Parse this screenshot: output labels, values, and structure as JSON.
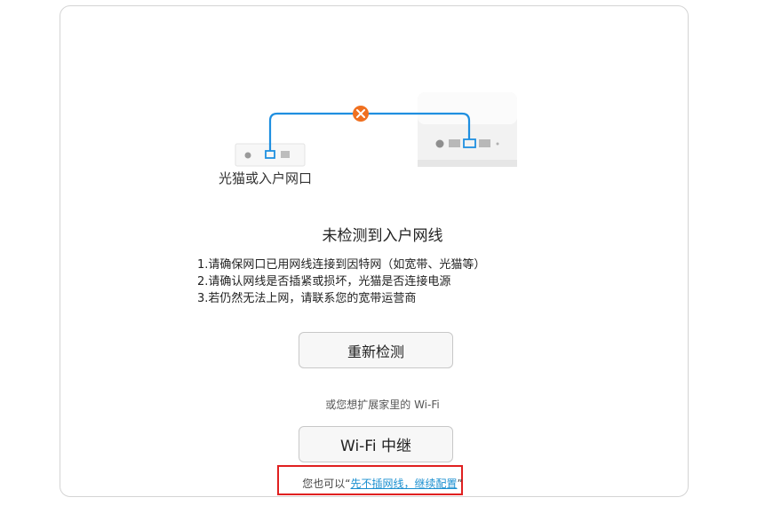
{
  "diagram": {
    "modem_label": "光猫或入户网口",
    "colors": {
      "cable": "#1f8fe0",
      "error": "#f07020"
    },
    "icons": [
      "modem-device-icon",
      "router-device-icon",
      "disconnect-error-icon"
    ]
  },
  "main": {
    "title": "未检测到入户网线",
    "steps": [
      "1.请确保网口已用网线连接到因特网（如宽带、光猫等）",
      "2.请确认网线是否插紧或损坏，光猫是否连接电源",
      "3.若仍然无法上网，请联系您的宽带运营商"
    ],
    "redetect_label": "重新检测",
    "extend_hint": "或您想扩展家里的 Wi-Fi",
    "relay_label": "Wi-Fi 中继",
    "skip_prefix": "您也可以",
    "skip_open_quote": "“",
    "skip_link": "先不插网线，继续配置",
    "skip_close_quote": "”"
  }
}
